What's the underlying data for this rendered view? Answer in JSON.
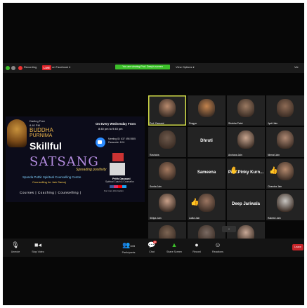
{
  "topbar": {
    "recording": "Recording",
    "live_badge": "LIVE",
    "live_on": "on Facebook ▾",
    "viewing_banner": "You are viewing Prof. Deep's screen",
    "view_options": "View Options ▾",
    "view_right": "Vie"
  },
  "share_content": {
    "left_line1": "Darling Free",
    "left_line2": "8.40 PM",
    "title_buddha": "BUDDHA",
    "title_purnima": "PURNIMA",
    "skillful": "Skillful",
    "satsang": "SATSANG",
    "spreading": "Spreading positivity",
    "org": "Spanda Puthir Spiritual Counselling Centre",
    "counselling": "Counselling for Jain Samaj",
    "tagline": "Courses | Coaching | Counselling |",
    "right_head1": "On Every Wednesday From",
    "right_head2": "8:40 pm to 9:40 pm",
    "meeting_line1": "Meeting ID: 637 498 5555",
    "meeting_line2": "Passcode: 1111",
    "host_name": "Prith Dassani",
    "host_sub": "Spiritual Coach & Counsellor",
    "more_info": "For more information"
  },
  "participants": [
    {
      "name": "Prof. Dassani",
      "type": "video",
      "face": "#b98b6e",
      "speaking": true
    },
    {
      "name": "Pragya",
      "type": "video",
      "face": "#c4844e"
    },
    {
      "name": "Shobha Patni",
      "type": "video",
      "face": "#9b7a62"
    },
    {
      "name": "Jyoti Jain",
      "type": "video",
      "face": "#8e6b55"
    },
    {
      "name": "Ravindra",
      "type": "video",
      "face": "#6f5a4c"
    },
    {
      "name": "Dhruti",
      "type": "name",
      "center": "Dhruti"
    },
    {
      "name": "Archana Jain",
      "type": "video",
      "face": "#c9a690"
    },
    {
      "name": "Nirmal Jain",
      "type": "video",
      "face": "#b08a74"
    },
    {
      "name": "Sunita Jain",
      "type": "video",
      "face": "#a57a60"
    },
    {
      "name": "Sameena",
      "type": "name",
      "center": "Sameena"
    },
    {
      "name": "Prof. Pinky Kum",
      "type": "name",
      "center": "Prof.Pinky Kurn...",
      "hand": "✋"
    },
    {
      "name": "Chandra Jain",
      "type": "video",
      "face": "#b58a6e",
      "hand": "👍"
    },
    {
      "name": "Shilpa Jain",
      "type": "video",
      "face": "#caa18a"
    },
    {
      "name": "Lalita Jain",
      "type": "video",
      "face": "#9c7662",
      "hand": "👍"
    },
    {
      "name": "Deep Jariwala",
      "type": "name",
      "center": "Deep Jariwala"
    },
    {
      "name": "Rakesh Jain",
      "type": "video",
      "face": "#c9c6c2"
    },
    {
      "name": "Anand Jain",
      "type": "video",
      "face": "#7d6553"
    },
    {
      "name": "Sushil Jain",
      "type": "video",
      "face": "#7a6a62"
    },
    {
      "name": "Prof. Jain",
      "type": "video",
      "face": "#c8a896"
    }
  ],
  "bottombar": {
    "unmute": "Unmute",
    "stop_video": "Stop Video",
    "participants": "Participants",
    "participants_count": "103",
    "chat": "Chat",
    "chat_badge": "20",
    "share_screen": "Share Screen",
    "record": "Record",
    "reactions": "Reactions",
    "leave": "Leave"
  },
  "colors": {
    "live_red": "#e0242a",
    "banner_green": "#3cc02a",
    "speaker_highlight": "#d6e04a",
    "leave_red": "#c8252a"
  }
}
